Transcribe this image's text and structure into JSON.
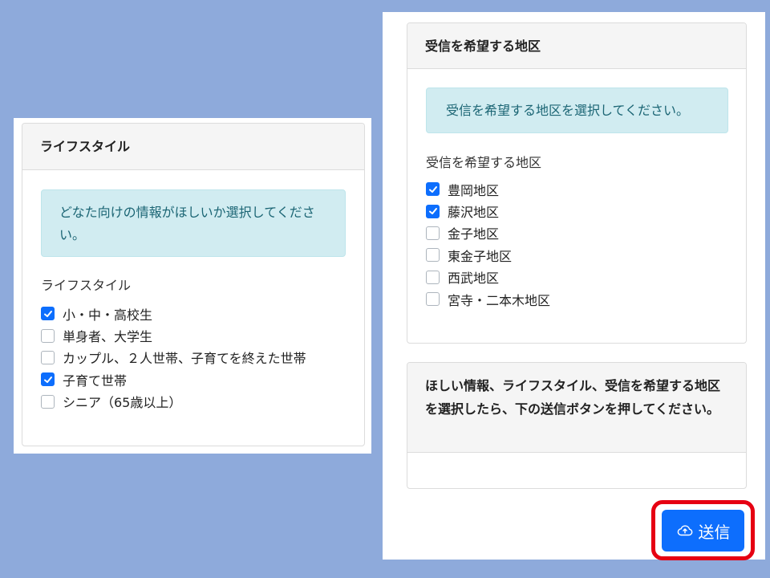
{
  "lifestyle_card": {
    "header": "ライフスタイル",
    "alert": "どなた向けの情報がほしいか選択してください。",
    "group_label": "ライフスタイル",
    "options": [
      {
        "label": "小・中・高校生",
        "checked": true
      },
      {
        "label": "単身者、大学生",
        "checked": false
      },
      {
        "label": "カップル、２人世帯、子育てを終えた世帯",
        "checked": false
      },
      {
        "label": "子育て世帯",
        "checked": true
      },
      {
        "label": "シニア（65歳以上）",
        "checked": false
      }
    ]
  },
  "district_card": {
    "header": "受信を希望する地区",
    "alert": "受信を希望する地区を選択してください。",
    "group_label": "受信を希望する地区",
    "options": [
      {
        "label": "豊岡地区",
        "checked": true
      },
      {
        "label": "藤沢地区",
        "checked": true
      },
      {
        "label": "金子地区",
        "checked": false
      },
      {
        "label": "東金子地区",
        "checked": false
      },
      {
        "label": "西武地区",
        "checked": false
      },
      {
        "label": "宮寺・二本木地区",
        "checked": false
      }
    ]
  },
  "instruction_card": {
    "text": "ほしい情報、ライフスタイル、受信を希望する地区を選択したら、下の送信ボタンを押してください。"
  },
  "send_button": {
    "label": "送信",
    "icon": "cloud-upload-icon"
  },
  "colors": {
    "background": "#8eaadb",
    "accent": "#0d6efd",
    "highlight_border": "#e60012",
    "alert_bg": "#d1ecf1",
    "alert_text": "#1b6574"
  }
}
